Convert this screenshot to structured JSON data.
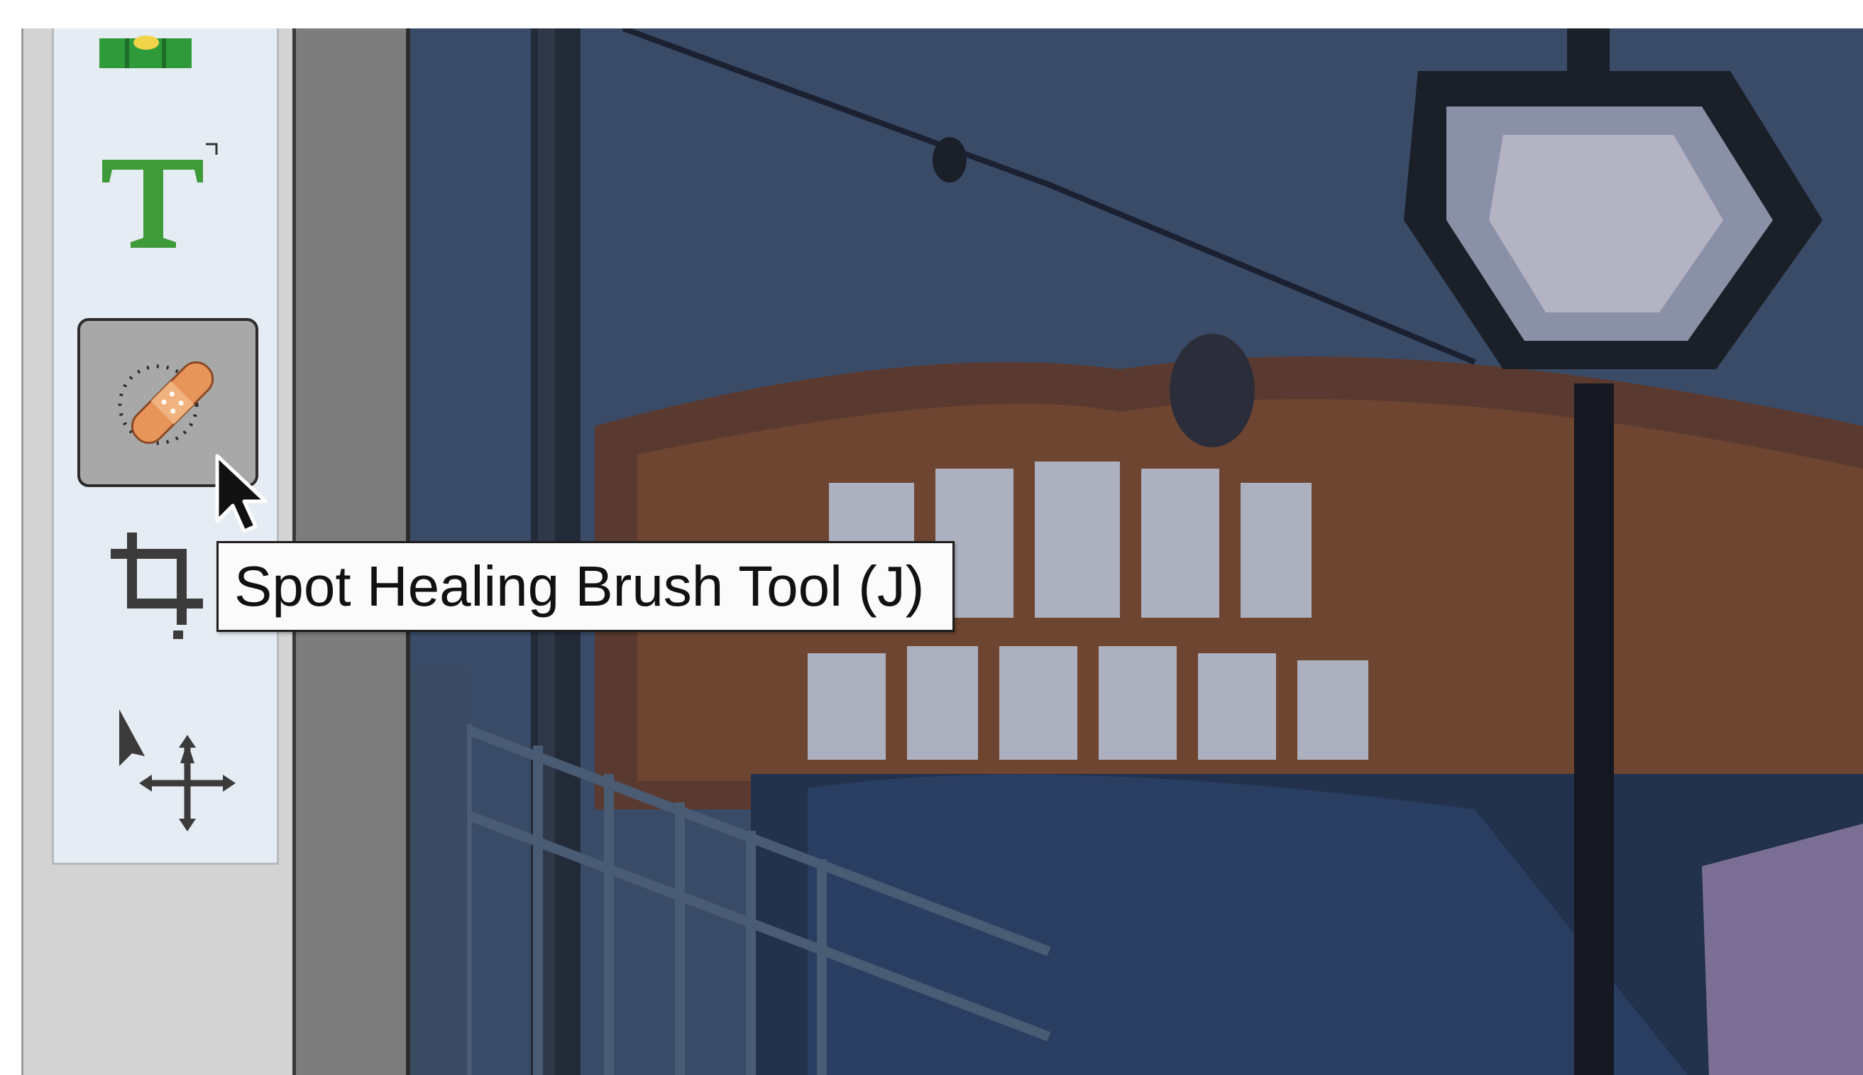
{
  "toolbar": {
    "tools": [
      {
        "id": "level-tool",
        "icon": "level-icon"
      },
      {
        "id": "type-tool",
        "icon": "type-t-icon"
      },
      {
        "id": "spot-healing-brush-tool",
        "icon": "bandage-icon",
        "selected": true
      },
      {
        "id": "crop-tool",
        "icon": "crop-icon"
      },
      {
        "id": "move-tool",
        "icon": "move-icon"
      }
    ]
  },
  "tooltip": {
    "text": "Spot Healing Brush Tool (J)"
  },
  "colors": {
    "type_tool_green": "#3f9a3a",
    "bandage_orange": "#e8955a",
    "level_green": "#2e9a3a",
    "canvas_sky": "#3c4d6a",
    "selected_tool_bg": "#a8a8a8"
  }
}
